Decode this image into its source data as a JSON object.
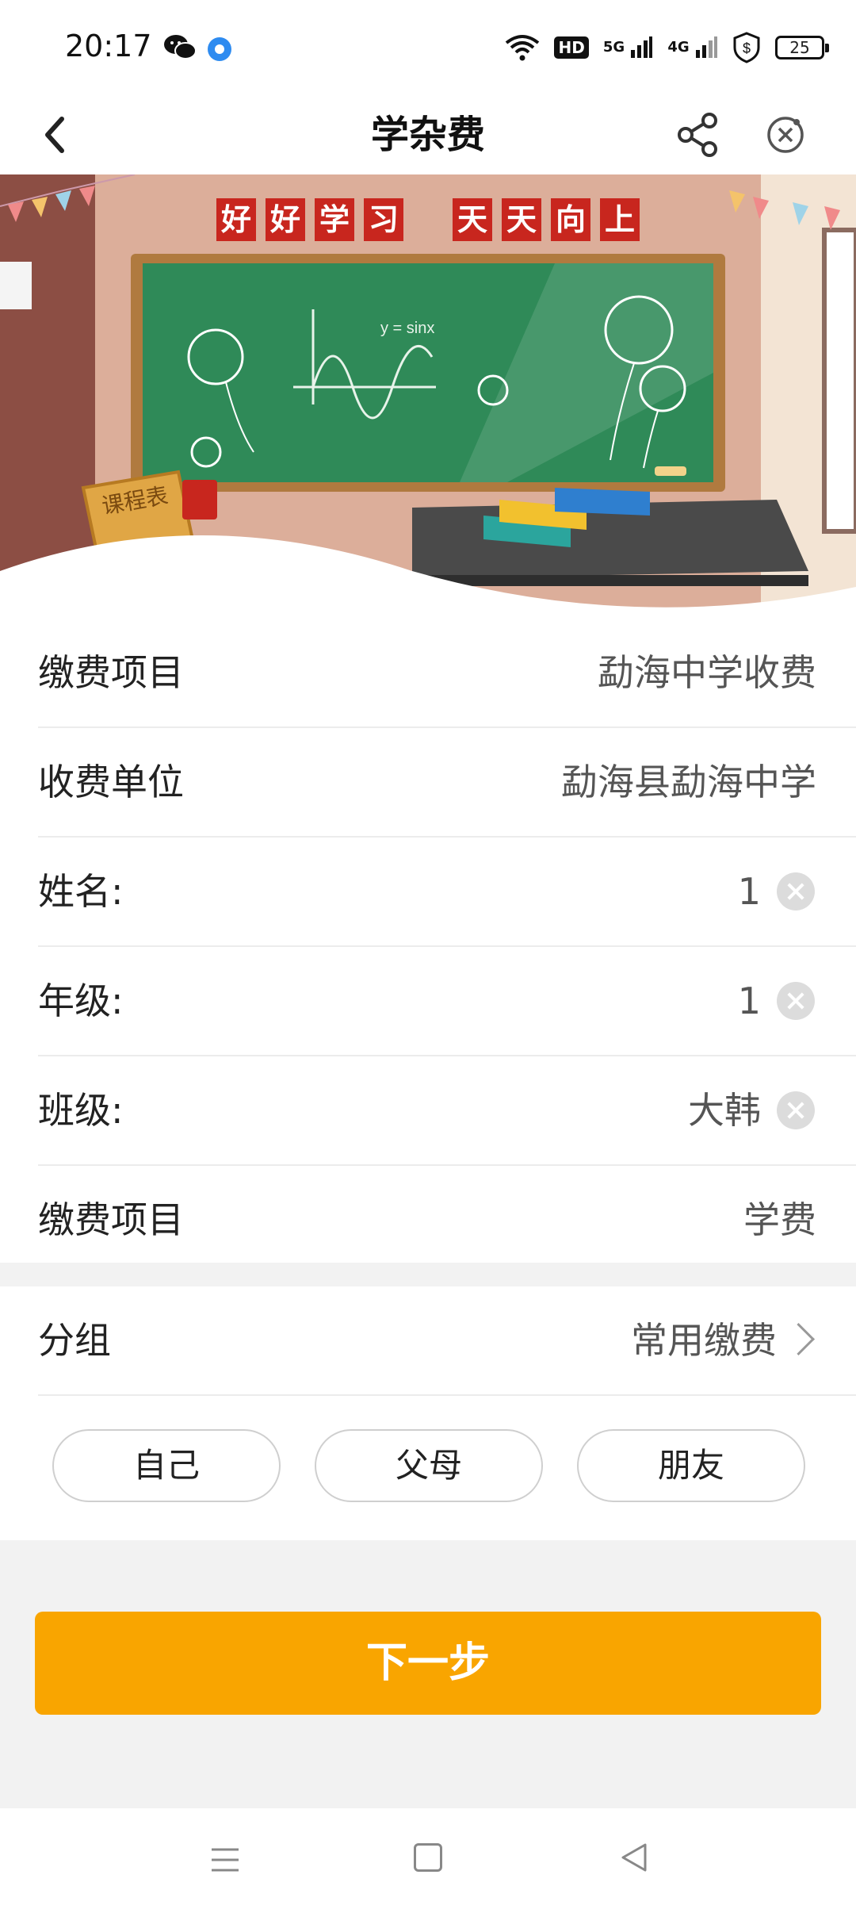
{
  "status_bar": {
    "time": "20:17",
    "hd": "HD",
    "net1": "5G",
    "net2": "4G",
    "battery": "25"
  },
  "header": {
    "title": "学杂费"
  },
  "banner": {
    "motto_left": [
      "好",
      "好",
      "学",
      "习"
    ],
    "motto_right": [
      "天",
      "天",
      "向",
      "上"
    ],
    "schedule_label": "课程表",
    "board_formula": "y = sinx"
  },
  "form": {
    "rows": [
      {
        "label": "缴费项目",
        "value": "勐海中学收费"
      },
      {
        "label": "收费单位",
        "value": "勐海县勐海中学"
      },
      {
        "label": "姓名:",
        "value": "1"
      },
      {
        "label": "年级:",
        "value": "1"
      },
      {
        "label": "班级:",
        "value": "大韩"
      },
      {
        "label": "缴费项目",
        "value": "学费"
      }
    ]
  },
  "group": {
    "label": "分组",
    "value": "常用缴费",
    "chips": [
      "自己",
      "父母",
      "朋友"
    ]
  },
  "next_button": "下一步",
  "colors": {
    "accent": "#f9a500",
    "board": "#2f8a58",
    "motto_red": "#c8261e"
  },
  "icons": {
    "back": "chevron-left-icon",
    "share": "share-icon",
    "close": "close-circle-icon",
    "clear": "clear-icon",
    "group_arrow": "chevron-right-icon"
  }
}
